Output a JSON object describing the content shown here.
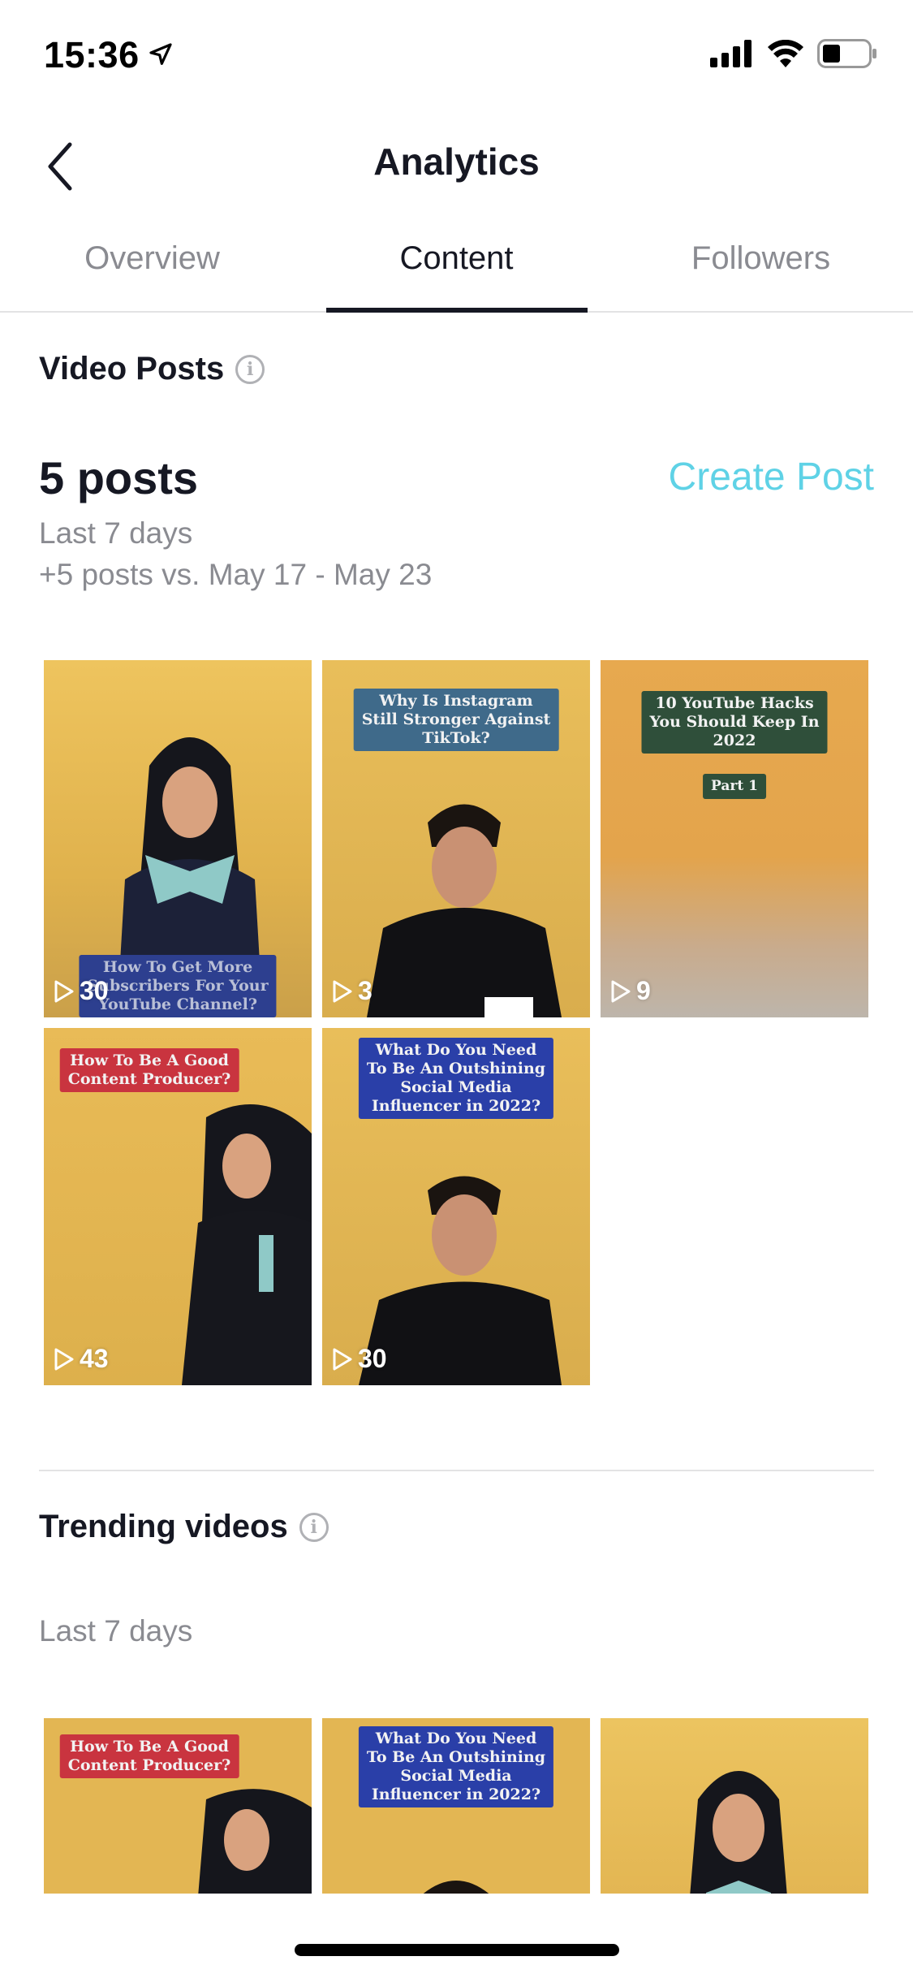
{
  "status_bar": {
    "time": "15:36",
    "location_icon": "location-arrow-icon",
    "signal_icon": "cellular-signal-icon",
    "wifi_icon": "wifi-icon",
    "battery_icon": "battery-icon",
    "battery_level": 0.35
  },
  "header": {
    "back_icon": "chevron-left-icon",
    "title": "Analytics"
  },
  "tabs": [
    {
      "label": "Overview",
      "active": false
    },
    {
      "label": "Content",
      "active": true
    },
    {
      "label": "Followers",
      "active": false
    }
  ],
  "video_posts": {
    "title": "Video Posts",
    "info_icon": "info-icon",
    "count_label": "5 posts",
    "create_post_label": "Create Post",
    "period": "Last 7 days",
    "comparison": "+5 posts vs. May 17 - May 23",
    "accent_color": "#5fd2e6",
    "videos": [
      {
        "caption": "How To Get More Subscribers For Your YouTube Channel?",
        "caption_lines": [
          "How To Get More",
          "Subscribers For Your",
          "YouTube Channel?"
        ],
        "views": "30",
        "caption_color": "#2d3f8f"
      },
      {
        "caption": "Why Is Instagram Still Stronger Against TikTok?",
        "caption_lines": [
          "Why Is Instagram",
          "Still Stronger Against",
          "TikTok?"
        ],
        "views": "3",
        "caption_color": "#3f6a8a"
      },
      {
        "caption": "10 YouTube Hacks You Should Keep In 2022 — Part 1",
        "caption_lines": [
          "10 YouTube Hacks",
          "You Should Keep In",
          "2022"
        ],
        "sub_caption": "Part 1",
        "views": "9",
        "caption_color": "#2f4f3a"
      },
      {
        "caption": "How To Be A Good Content Producer?",
        "caption_lines": [
          "How To Be A Good",
          "Content Producer?"
        ],
        "views": "43",
        "caption_color": "#c9343f"
      },
      {
        "caption": "What Do You Need To Be An Outshining Social Media Influencer in 2022?",
        "caption_lines": [
          "What Do You Need",
          "To Be An Outshining",
          "Social Media",
          "Influencer in 2022?"
        ],
        "views": "30",
        "caption_color": "#2a3fa8"
      }
    ]
  },
  "trending_videos": {
    "title": "Trending videos",
    "info_icon": "info-icon",
    "period": "Last 7 days",
    "videos": [
      {
        "caption": "How To Be A Good Content Producer?",
        "caption_lines": [
          "How To Be A Good",
          "Content Producer?"
        ],
        "caption_color": "#c9343f"
      },
      {
        "caption": "What Do You Need To Be An Outshining Social Media Influencer in 2022?",
        "caption_lines": [
          "What Do You Need",
          "To Be An Outshining",
          "Social Media",
          "Influencer in 2022?"
        ],
        "caption_color": "#2a3fa8"
      },
      {
        "caption": "",
        "caption_lines": []
      }
    ]
  }
}
